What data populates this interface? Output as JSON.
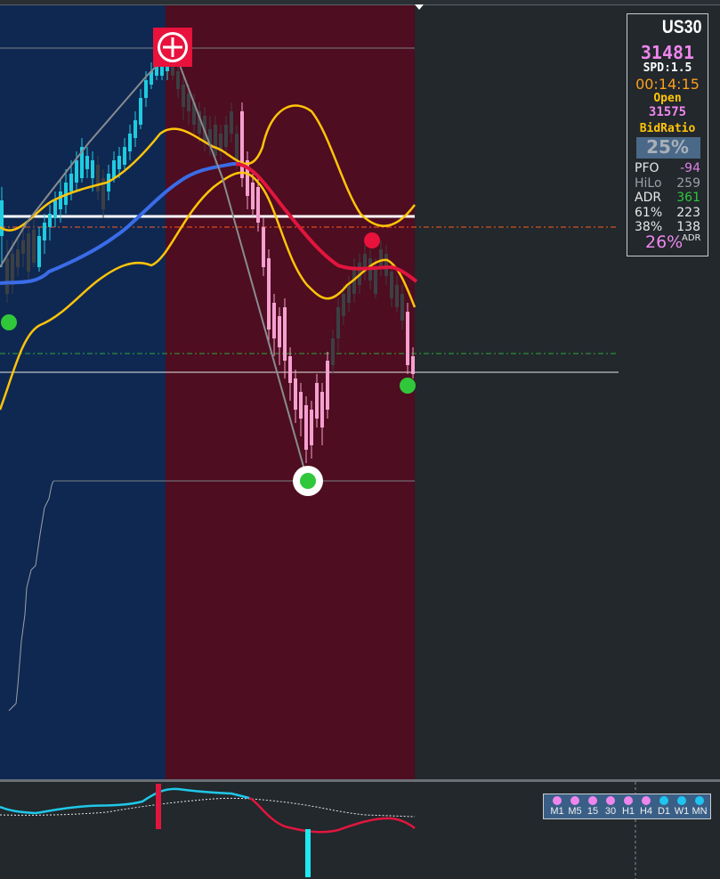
{
  "colors": {
    "background": "#22282c",
    "zone_buy": "#0f2852",
    "zone_sell": "#4e0d20",
    "bull_candle": "#1ecce0",
    "bear_candle": "#f5a0d0",
    "neutral_candle": "#3c3f43",
    "envelope": "#ffc40a",
    "ma_blue": "#3a6ce8",
    "ma_red": "#e0163e",
    "green_dot": "#30c83a",
    "red_dot": "#e8123c",
    "tf_pink": "#ef86ee",
    "tf_cyan": "#1ec5f0"
  },
  "info_panel": {
    "symbol": "US30",
    "price": "31481",
    "spread": "SPD:1.5",
    "timer": "00:14:15",
    "open_label": "Open",
    "open_value": "31575",
    "bid_ratio_label": "BidRatio",
    "bid_ratio_value": "25%",
    "stats": [
      {
        "label": "PFO",
        "value": "-94",
        "label_color": "#e8e8e8",
        "value_color": "#e080e8"
      },
      {
        "label": "HiLo",
        "value": "259",
        "label_color": "#9aa0a6",
        "value_color": "#9aa0a6"
      },
      {
        "label": "ADR",
        "value": "361",
        "label_color": "#e8e8e8",
        "value_color": "#30c83a"
      },
      {
        "label": "61%",
        "value": "223",
        "label_color": "#e8e8e8",
        "value_color": "#e8e8e8"
      },
      {
        "label": "38%",
        "value": "138",
        "label_color": "#e8e8e8",
        "value_color": "#e8e8e8"
      }
    ],
    "adr_pct": "26%",
    "adr_suffix": "ADR"
  },
  "timeframes": [
    {
      "label": "M1",
      "color": "#ef86ee"
    },
    {
      "label": "M5",
      "color": "#ef86ee"
    },
    {
      "label": "15",
      "color": "#ef86ee"
    },
    {
      "label": "30",
      "color": "#ef86ee"
    },
    {
      "label": "H1",
      "color": "#ef86ee"
    },
    {
      "label": "H4",
      "color": "#ef86ee"
    },
    {
      "label": "D1",
      "color": "#1ec5f0"
    },
    {
      "label": "W1",
      "color": "#1ec5f0"
    },
    {
      "label": "MN",
      "color": "#1ec5f0"
    }
  ]
}
